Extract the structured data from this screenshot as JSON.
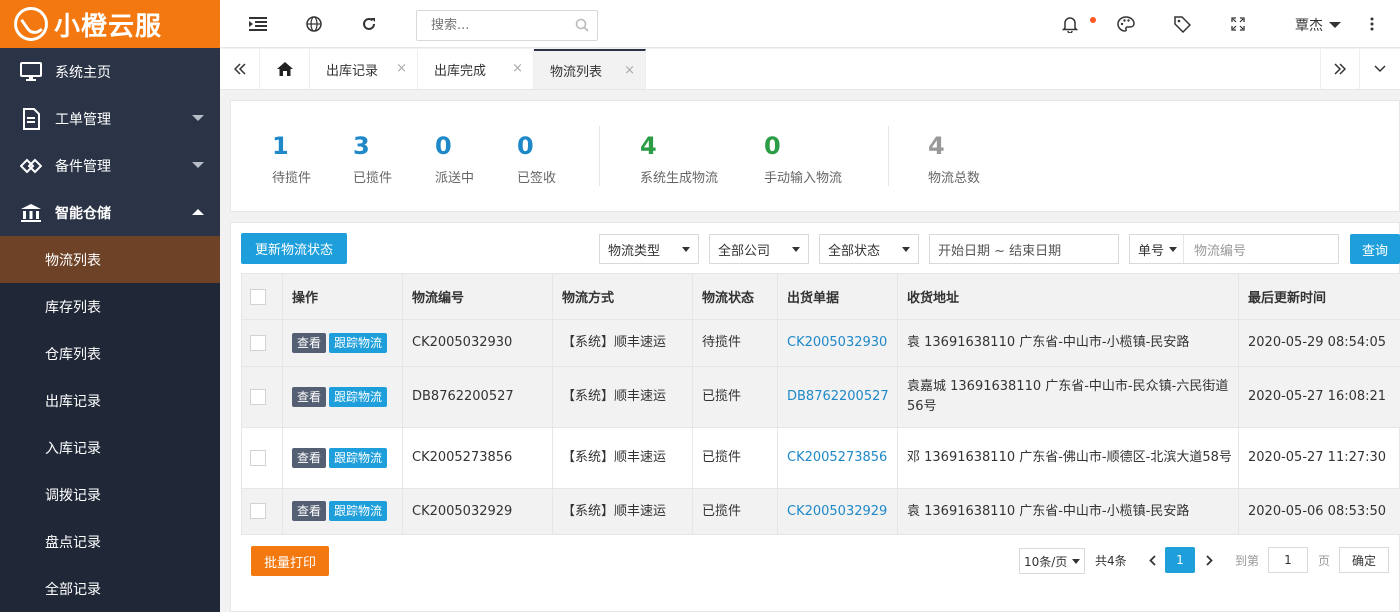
{
  "app": {
    "logo_text": "小橙云服"
  },
  "sidebar": {
    "items": [
      {
        "label": "系统主页",
        "icon": "monitor-icon"
      },
      {
        "label": "工单管理",
        "icon": "document-icon"
      },
      {
        "label": "备件管理",
        "icon": "diamond-link-icon"
      },
      {
        "label": "智能仓储",
        "icon": "warehouse-icon"
      }
    ],
    "sub_items": [
      {
        "label": "物流列表",
        "active": true
      },
      {
        "label": "库存列表"
      },
      {
        "label": "仓库列表"
      },
      {
        "label": "出库记录"
      },
      {
        "label": "入库记录"
      },
      {
        "label": "调拨记录"
      },
      {
        "label": "盘点记录"
      },
      {
        "label": "全部记录"
      }
    ]
  },
  "header": {
    "search_placeholder": "搜索...",
    "user_name": "覃杰"
  },
  "tabs": [
    {
      "label": "出库记录"
    },
    {
      "label": "出库完成"
    },
    {
      "label": "物流列表",
      "active": true
    }
  ],
  "tab_close": "×",
  "stats": [
    {
      "num": "1",
      "label": "待揽件",
      "color": "#1e88c9"
    },
    {
      "num": "3",
      "label": "已揽件",
      "color": "#1e88c9"
    },
    {
      "num": "0",
      "label": "派送中",
      "color": "#1e88c9"
    },
    {
      "num": "0",
      "label": "已签收",
      "color": "#1e88c9"
    },
    {
      "num": "4",
      "label": "系统生成物流",
      "color": "#2a9d46"
    },
    {
      "num": "0",
      "label": "手动输入物流",
      "color": "#2a9d46"
    },
    {
      "num": "4",
      "label": "物流总数",
      "color": "#999999"
    }
  ],
  "toolbar": {
    "update_button": "更新物流状态",
    "filter_type": "物流类型",
    "filter_company": "全部公司",
    "filter_status": "全部状态",
    "date_range": "开始日期 ~ 结束日期",
    "no_select": "单号",
    "no_placeholder": "物流编号",
    "query_button": "查询"
  },
  "table": {
    "headers": [
      "操作",
      "物流编号",
      "物流方式",
      "物流状态",
      "出货单据",
      "收货地址",
      "最后更新时间"
    ],
    "view_label": "查看",
    "track_label": "跟踪物流",
    "rows": [
      {
        "no": "CK2005032930",
        "method": "【系统】顺丰速运",
        "status": "待揽件",
        "doc": "CK2005032930",
        "addr": "袁 13691638110 广东省-中山市-小榄镇-民安路",
        "time": "2020-05-29 08:54:05"
      },
      {
        "no": "DB8762200527",
        "method": "【系统】顺丰速运",
        "status": "已揽件",
        "doc": "DB8762200527",
        "addr": "袁嘉城 13691638110 广东省-中山市-民众镇-六民街道56号",
        "time": "2020-05-27 16:08:21"
      },
      {
        "no": "CK2005273856",
        "method": "【系统】顺丰速运",
        "status": "已揽件",
        "doc": "CK2005273856",
        "addr": "邓 13691638110 广东省-佛山市-顺德区-北滨大道58号",
        "time": "2020-05-27 11:27:30"
      },
      {
        "no": "CK2005032929",
        "method": "【系统】顺丰速运",
        "status": "已揽件",
        "doc": "CK2005032929",
        "addr": "袁 13691638110 广东省-中山市-小榄镇-民安路",
        "time": "2020-05-06 08:53:50"
      }
    ]
  },
  "footer": {
    "batch_print": "批量打印",
    "page_size": "10条/页",
    "total": "共4条",
    "current_page": "1",
    "goto_label": "到第",
    "goto_value": "1",
    "page_unit": "页",
    "confirm": "确定"
  }
}
